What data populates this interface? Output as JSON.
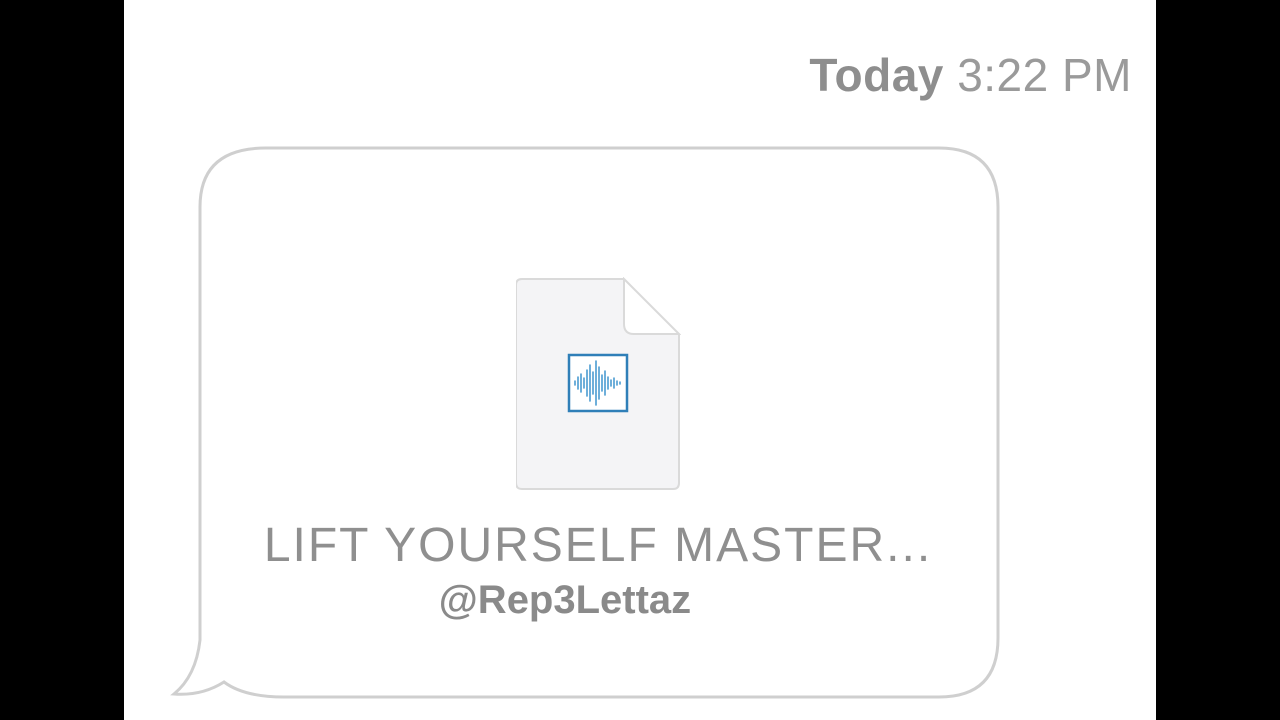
{
  "header": {
    "date_label": "Today",
    "time_label": "3:22 PM"
  },
  "message": {
    "attachment": {
      "icon": "audio-file-icon",
      "filename": "LIFT YOURSELF MASTER..."
    },
    "watermark": "@Rep3Lettaz"
  },
  "colors": {
    "background": "#ffffff",
    "letterbox": "#000000",
    "bubble_border": "#cfcfcf",
    "text_gray": "#8f8f8f",
    "waveform_accent": "#2f7fb8"
  }
}
